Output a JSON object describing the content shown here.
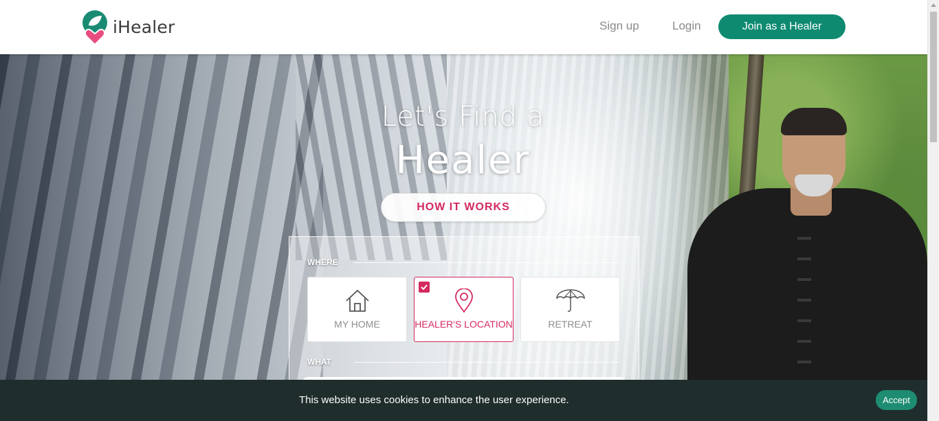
{
  "header": {
    "logo_text": "iHealer",
    "signup_label": "Sign up",
    "login_label": "Login",
    "join_label": "Join as a Healer"
  },
  "hero": {
    "title_line1": "Let's Find a",
    "title_line2": "Healer",
    "how_it_works_label": "HOW IT WORKS"
  },
  "search": {
    "where_label": "WHERE",
    "what_label": "WHAT",
    "options": [
      {
        "label": "MY HOME",
        "icon": "house-icon",
        "selected": false
      },
      {
        "label": "HEALER'S LOCATION",
        "icon": "map-pin-icon",
        "selected": true
      },
      {
        "label": "RETREAT",
        "icon": "umbrella-icon",
        "selected": false
      }
    ]
  },
  "cookie": {
    "message": "This website uses cookies to enhance the user experience.",
    "accept_label": "Accept"
  },
  "colors": {
    "brand_green": "#0e8a71",
    "accent_pink": "#d42a5f",
    "cookie_bg": "#1f2d2c"
  }
}
